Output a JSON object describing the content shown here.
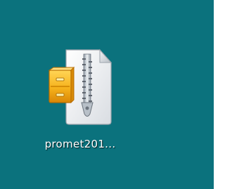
{
  "desktop": {
    "background_color": "#0b727d",
    "icons": [
      {
        "label": "promet201...",
        "icon": "zip-archive-file-icon",
        "accent_color": "#f6b21c"
      }
    ]
  }
}
